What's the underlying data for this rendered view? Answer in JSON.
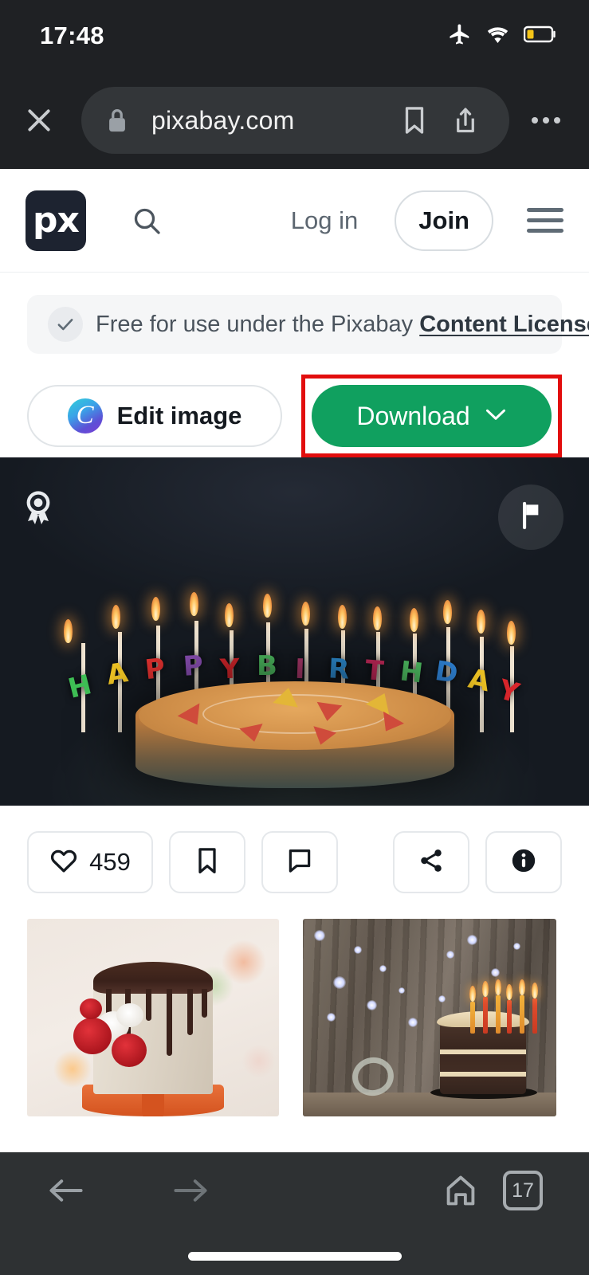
{
  "status_bar": {
    "time": "17:48",
    "icons": [
      "airplane-icon",
      "wifi-icon",
      "battery-low-icon"
    ],
    "battery_color": "#f5c518"
  },
  "browser": {
    "close_label": "close-icon",
    "url": "pixabay.com",
    "secure": true,
    "lock_icon": "lock-icon",
    "bookmark_icon": "bookmark-icon",
    "share_icon": "share-up-icon",
    "overflow_icon": "more-options-icon",
    "chrome_color": "#1f2124",
    "url_pill_color": "#333639"
  },
  "site_header": {
    "logo_text": "px",
    "logo_bg": "#1d2330",
    "search_icon": "search-icon",
    "login_label": "Log in",
    "join_label": "Join",
    "menu_icon": "hamburger-menu-icon"
  },
  "license_banner": {
    "check_icon": "checkmark-icon",
    "text": "Free for use under the Pixabay ",
    "link_text": "Content License"
  },
  "action_buttons": {
    "edit_label": "Edit image",
    "edit_icon": "canva-c-icon",
    "download_label": "Download",
    "download_chevron": "chevron-down-icon",
    "download_color": "#10a05f",
    "highlight_color": "#e20d0d",
    "highlighted": "download-button"
  },
  "hero_image": {
    "alt": "Happy birthday candles on a cake",
    "award_icon": "award-badge-icon",
    "flag_icon": "flag-report-icon",
    "background": "#151a21",
    "candle_text": "HAPPYBIRTHDAY",
    "candle_letters": [
      {
        "ch": "H",
        "color": "#3fbf55"
      },
      {
        "ch": "A",
        "color": "#f1c524"
      },
      {
        "ch": "P",
        "color": "#e0312f"
      },
      {
        "ch": "P",
        "color": "#8b4fb5"
      },
      {
        "ch": "Y",
        "color": "#d9262c"
      },
      {
        "ch": "B",
        "color": "#4fbf62"
      },
      {
        "ch": "I",
        "color": "#b03a6f"
      },
      {
        "ch": "R",
        "color": "#2e8fd6"
      },
      {
        "ch": "T",
        "color": "#c4295a"
      },
      {
        "ch": "H",
        "color": "#4fbf62"
      },
      {
        "ch": "D",
        "color": "#2e7fd0"
      },
      {
        "ch": "A",
        "color": "#f1c524"
      },
      {
        "ch": "Y",
        "color": "#d9262c"
      }
    ]
  },
  "engagement": {
    "like_icon": "heart-icon",
    "like_count": "459",
    "bookmark_icon": "bookmark-icon",
    "comment_icon": "comment-icon",
    "share_icon": "share-network-icon",
    "info_icon": "info-icon"
  },
  "related_thumbnails": [
    {
      "name": "white-drip-cake-with-roses",
      "alt": "White cake with chocolate drip and red roses"
    },
    {
      "name": "chocolate-cake-with-candles",
      "alt": "Chocolate layer cake with lit candles"
    }
  ],
  "bottom_nav": {
    "back_icon": "arrow-left-icon",
    "forward_icon": "arrow-right-icon",
    "home_icon": "home-icon",
    "tab_count": "17",
    "bar_color": "#2e3133"
  }
}
